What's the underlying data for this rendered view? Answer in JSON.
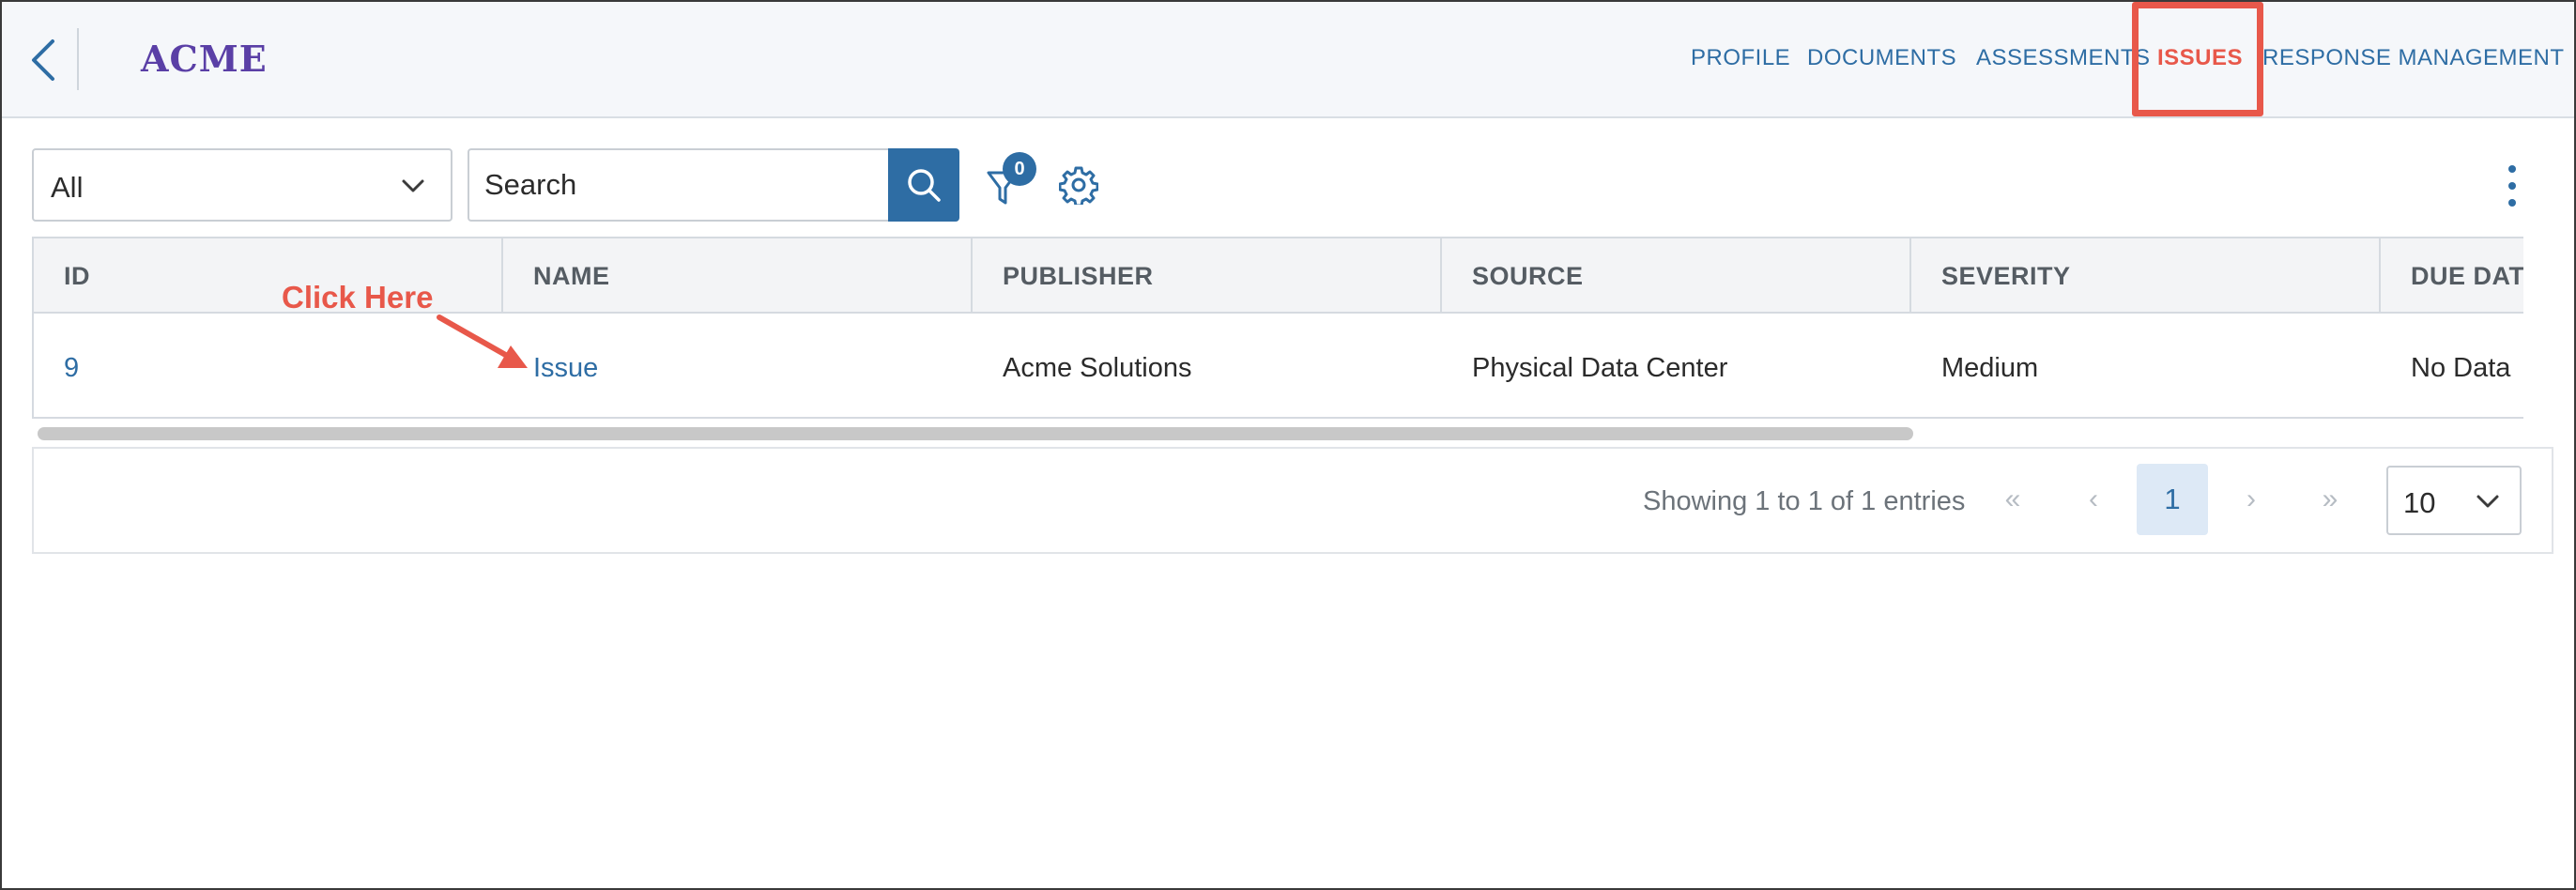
{
  "header": {
    "logo": "ACME",
    "nav": [
      {
        "label": "PROFILE",
        "active": false
      },
      {
        "label": "DOCUMENTS",
        "active": false
      },
      {
        "label": "ASSESSMENTS",
        "active": false
      },
      {
        "label": "ISSUES",
        "active": true
      },
      {
        "label": "RESPONSE MANAGEMENT",
        "active": false
      }
    ]
  },
  "toolbar": {
    "filter_select_value": "All",
    "search_placeholder": "Search",
    "filter_count": "0"
  },
  "table": {
    "columns": [
      "ID",
      "NAME",
      "PUBLISHER",
      "SOURCE",
      "SEVERITY",
      "DUE DAT"
    ],
    "rows": [
      {
        "id": "9",
        "name": "Issue",
        "publisher": "Acme Solutions",
        "source": "Physical Data Center",
        "severity": "Medium",
        "due_date": "No Data"
      }
    ]
  },
  "pagination": {
    "entries_text": "Showing 1 to 1 of 1 entries",
    "first": "«",
    "prev": "‹",
    "current_page": "1",
    "next": "›",
    "last": "»",
    "page_size": "10"
  },
  "annotation": {
    "callout_text": "Click Here"
  },
  "colors": {
    "accent": "#2e6da4",
    "highlight": "#e8584a",
    "logo": "#5a3fa6"
  }
}
